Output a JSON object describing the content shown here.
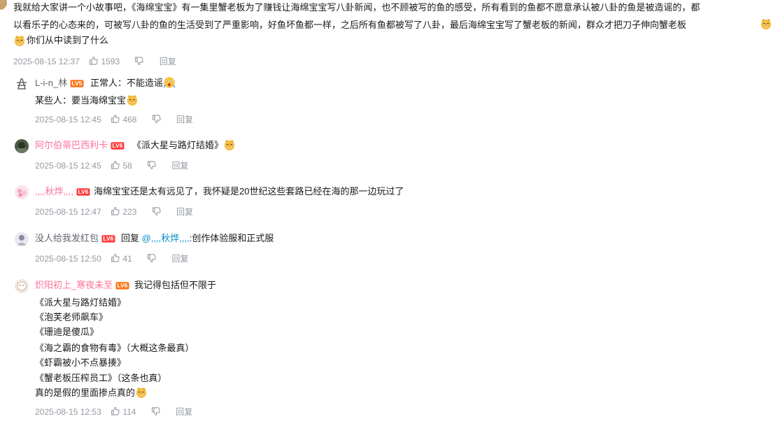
{
  "root_comment": {
    "line1": "我就给大家讲一个小故事吧，《海绵宝宝》有一集里蟹老板为了赚钱让海绵宝宝写八卦新闻，也不顾被写的鱼的感受，所有看到的鱼都不愿意承认被八卦的鱼是被造谣的，都",
    "line2": "以看乐子的心态来的，可被写八卦的鱼的生活受到了严重影响，好鱼坏鱼都一样，之后所有鱼都被写了八卦，最后海绵宝宝写了蟹老板的新闻，群众才把刀子伸向蟹老板",
    "line3": "你们从中读到了什么",
    "time": "2025-08-15 12:37",
    "likes": "1593",
    "reply_label": "回复"
  },
  "replies": [
    {
      "username": "L-i-n_林",
      "level": "LV5",
      "lines": [
        "正常人：不能造谣",
        "某些人：要当海绵宝宝"
      ],
      "time": "2025-08-15 12:45",
      "likes": "468",
      "reply_label": "回复"
    },
    {
      "username": "阿尔伯蒂巴西利卡",
      "level": "LV6",
      "lines": [
        "《派大星与路灯结婚》"
      ],
      "time": "2025-08-15 12:45",
      "likes": "58",
      "reply_label": "回复"
    },
    {
      "username": ",,,,秋烨,,,,",
      "level": "LV6",
      "lines": [
        "海绵宝宝还是太有远见了，我怀疑是20世纪这些套路已经在海的那一边玩过了"
      ],
      "time": "2025-08-15 12:47",
      "likes": "223",
      "reply_label": "回复"
    },
    {
      "username": "没人给我发红包",
      "level": "LV6",
      "reply_prefix": "回复",
      "mention": "@,,,,秋烨,,,,",
      "lines": [
        ":创作体验服和正式服"
      ],
      "time": "2025-08-15 12:50",
      "likes": "41",
      "reply_label": "回复"
    },
    {
      "username": "炽阳初上_寒夜未至",
      "level": "LV6",
      "lines": [
        "我记得包括但不限于",
        "《派大星与路灯结婚》",
        "《泡芙老师飙车》",
        "《珊迪是傻瓜》",
        "《海之霸的食物有毒》（大概这条最真）",
        "《虾霸被小不点暴揍》",
        "《蟹老板压榨员工》（这条也真）",
        "真的是假的里面掺点真的"
      ],
      "time": "2025-08-15 12:53",
      "likes": "114",
      "reply_label": "回复"
    }
  ],
  "emoji_names": [
    "doge-emoji",
    "shocked-emoji"
  ]
}
